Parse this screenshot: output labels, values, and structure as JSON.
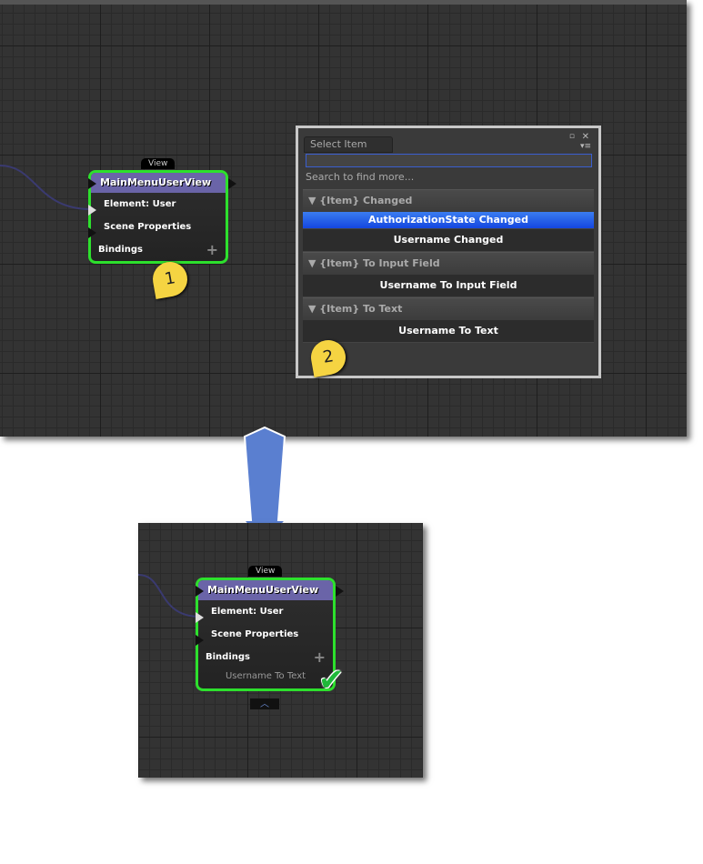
{
  "node": {
    "tag": "View",
    "title": "MainMenuUserView",
    "element": "Element: User",
    "scene": "Scene Properties",
    "bindings": "Bindings",
    "plus": "+"
  },
  "popup": {
    "tab": "Select Item",
    "search_value": "",
    "hint": "Search to find more...",
    "groups": [
      {
        "label": "▼ {Item} Changed",
        "items": [
          "AuthorizationState Changed",
          "Username Changed"
        ]
      },
      {
        "label": "▼ {Item} To Input Field",
        "items": [
          "Username To Input Field"
        ]
      },
      {
        "label": "▼ {Item} To Text",
        "items": [
          "Username To Text"
        ]
      }
    ],
    "close": "✕",
    "restore": "▫",
    "menu": "▾≡"
  },
  "callouts": {
    "one": "1",
    "two": "2"
  },
  "result": {
    "binding": "Username To Text",
    "check": "✔",
    "collapse": "︿"
  },
  "colors": {
    "node_border": "#2de02d",
    "header": "#6a64a8",
    "selected": "#1446e0",
    "arrow": "#5a7fd0"
  }
}
